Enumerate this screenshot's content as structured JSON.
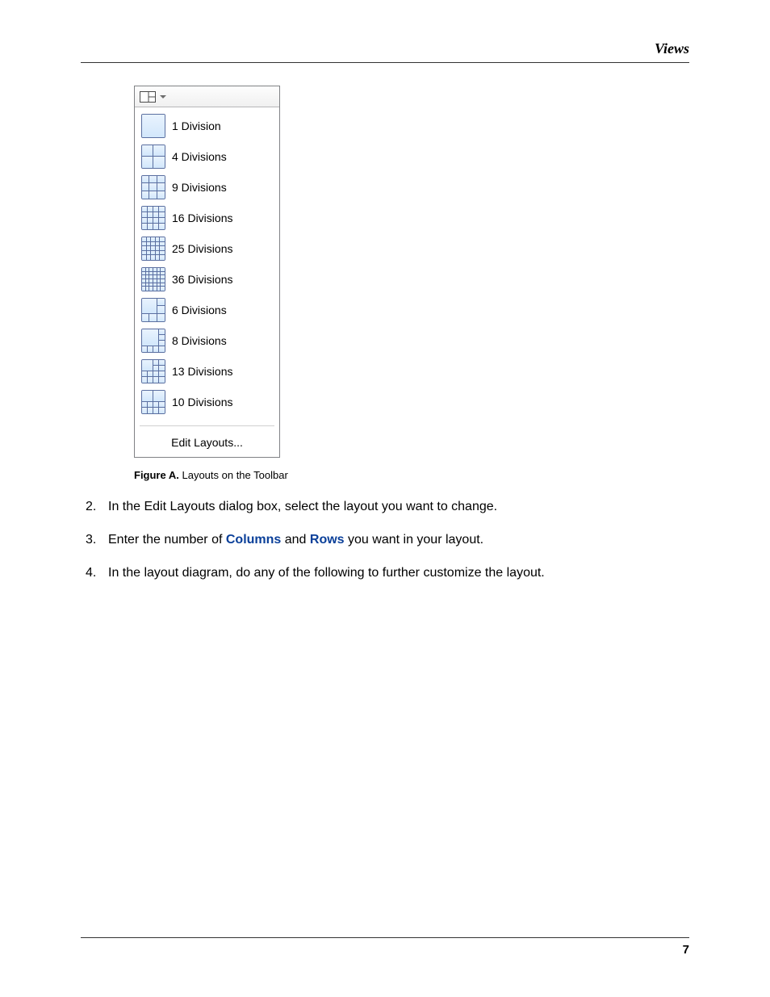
{
  "header": {
    "title": "Views"
  },
  "footer": {
    "page_number": "7"
  },
  "figure": {
    "caption_label": "Figure A.",
    "caption_text": "Layouts on the Toolbar",
    "toolbar_icon": "layout-split-icon",
    "items": [
      {
        "label": "1 Division",
        "grid": [
          1,
          1
        ],
        "pattern": null
      },
      {
        "label": "4 Divisions",
        "grid": [
          2,
          2
        ],
        "pattern": null
      },
      {
        "label": "9 Divisions",
        "grid": [
          3,
          3
        ],
        "pattern": null
      },
      {
        "label": "16 Divisions",
        "grid": [
          4,
          4
        ],
        "pattern": null
      },
      {
        "label": "25 Divisions",
        "grid": [
          5,
          5
        ],
        "pattern": null
      },
      {
        "label": "36 Divisions",
        "grid": [
          6,
          6
        ],
        "pattern": null
      },
      {
        "label": "6 Divisions",
        "grid": [
          3,
          3
        ],
        "pattern": "onebig3"
      },
      {
        "label": "8 Divisions",
        "grid": [
          4,
          4
        ],
        "pattern": "onebig4"
      },
      {
        "label": "13 Divisions",
        "grid": [
          4,
          4
        ],
        "pattern": "twowide4"
      },
      {
        "label": "10 Divisions",
        "grid": [
          4,
          4
        ],
        "pattern": "halfbig4"
      }
    ],
    "edit_label": "Edit Layouts..."
  },
  "steps": [
    {
      "n": "2.",
      "parts": [
        {
          "t": "In the Edit Layouts dialog box, select the layout you want to change."
        }
      ]
    },
    {
      "n": "3.",
      "parts": [
        {
          "t": "Enter the number of "
        },
        {
          "t": "Columns",
          "kw": true
        },
        {
          "t": " and "
        },
        {
          "t": "Rows",
          "kw": true
        },
        {
          "t": " you want in your layout."
        }
      ]
    },
    {
      "n": "4.",
      "parts": [
        {
          "t": "In the layout diagram, do any of the following to further customize the layout."
        }
      ]
    }
  ]
}
